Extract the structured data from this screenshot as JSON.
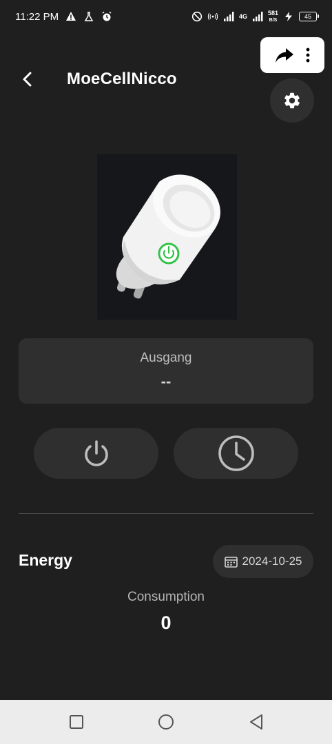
{
  "status_bar": {
    "time": "11:22 PM",
    "net_type": "4G",
    "net_speed": "581",
    "net_unit": "B/S",
    "battery": "45",
    "icons": [
      "warning-icon",
      "flask-icon",
      "alarm-icon",
      "do-not-disturb-icon",
      "hotspot-icon",
      "signal-icon",
      "signal-icon",
      "charging-icon",
      "battery-icon"
    ]
  },
  "header": {
    "title": "MoeCellNicco",
    "back_icon": "chevron-left-icon",
    "settings_icon": "gear-icon",
    "menu_icons": [
      "share-icon",
      "more-vert-icon"
    ]
  },
  "output": {
    "label": "Ausgang",
    "value": "--"
  },
  "controls": {
    "power_icon": "power-icon",
    "timer_icon": "clock-icon"
  },
  "energy": {
    "title": "Energy",
    "date": "2024-10-25",
    "consumption_label": "Consumption",
    "consumption_value": "0"
  },
  "colors": {
    "background": "#1f1f1f",
    "card": "#2f2f2f",
    "accent_led": "#35c24a",
    "nav_bar": "#ececec"
  }
}
